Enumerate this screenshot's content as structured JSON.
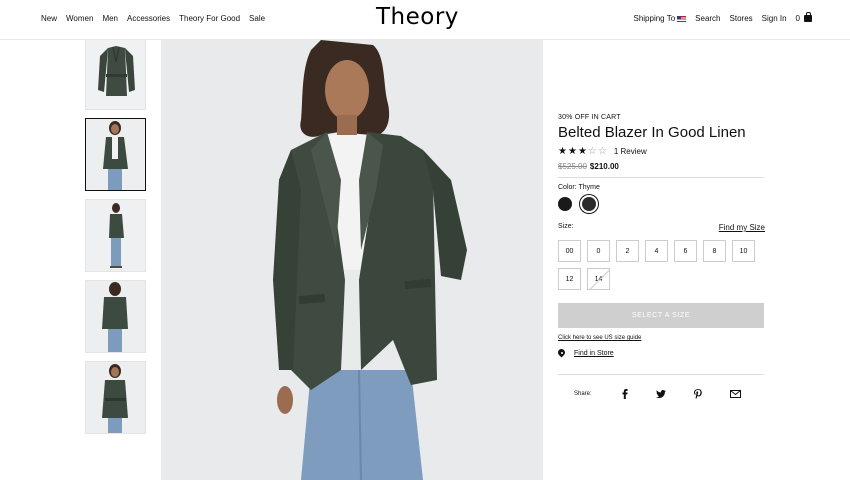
{
  "brand": "Theory",
  "nav_left": [
    "New",
    "Women",
    "Men",
    "Accessories",
    "Theory For Good",
    "Sale"
  ],
  "nav_right": {
    "shipping": "Shipping To",
    "search": "Search",
    "stores": "Stores",
    "signin": "Sign In",
    "bag_count": "0"
  },
  "product": {
    "promo": "30% OFF IN CART",
    "title": "Belted Blazer In Good Linen",
    "rating_stars": 3,
    "rating_max": 5,
    "reviews": "1 Review",
    "old_price": "$525.00",
    "new_price": "$210.00",
    "color_label": "Color: Thyme",
    "size_label": "Size:",
    "find_size": "Find my Size",
    "sizes": [
      "00",
      "0",
      "2",
      "4",
      "6",
      "8",
      "10",
      "12",
      "14"
    ],
    "unavailable_size": "14",
    "select_button": "SELECT A SIZE",
    "us_size_guide": "Click here to see US size guide",
    "find_store": "Find in Store",
    "share_label": "Share:"
  },
  "colors": {
    "swatch_black": "#1a1a1a",
    "swatch_thyme": "#2b2d2a",
    "button_disabled": "#cfcfcf"
  }
}
